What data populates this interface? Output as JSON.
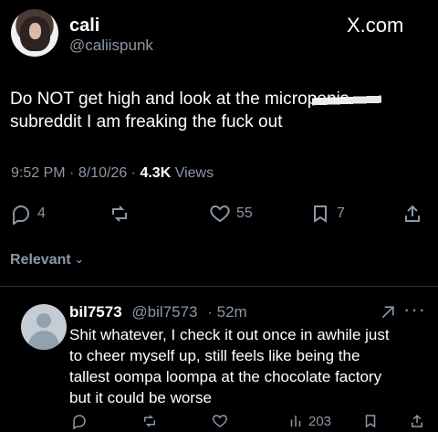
{
  "profile": {
    "name": "cali",
    "handle": "@caliispunk",
    "site": "X.com"
  },
  "tweet": {
    "lines": [
      "Do NOT get high and look at the micropenis",
      "subreddit I am freaking the fuck out"
    ],
    "time": "9:52 PM",
    "date": "8/10/26",
    "views": "4.3K",
    "views_label": "Views",
    "reply_count": "4",
    "like_count": "55",
    "bookmark_count": "7"
  },
  "sort": {
    "label": "Relevant"
  },
  "reply": {
    "name": "bil7573",
    "handle": "@bil7573",
    "time": "52m",
    "lines": [
      "Shit whatever, I check it out once in awhile just",
      "to cheer myself up, still feels like being the",
      "tallest oompa loompa at the  chocolate factory",
      "but it could be worse"
    ],
    "views": "203"
  },
  "icons": {
    "reply": "reply-icon",
    "repost": "repost-icon",
    "like": "heart-icon",
    "bookmark": "bookmark-icon",
    "share": "share-icon",
    "views": "bar-chart-icon",
    "more": "more-icon",
    "grok": "grok-icon"
  }
}
